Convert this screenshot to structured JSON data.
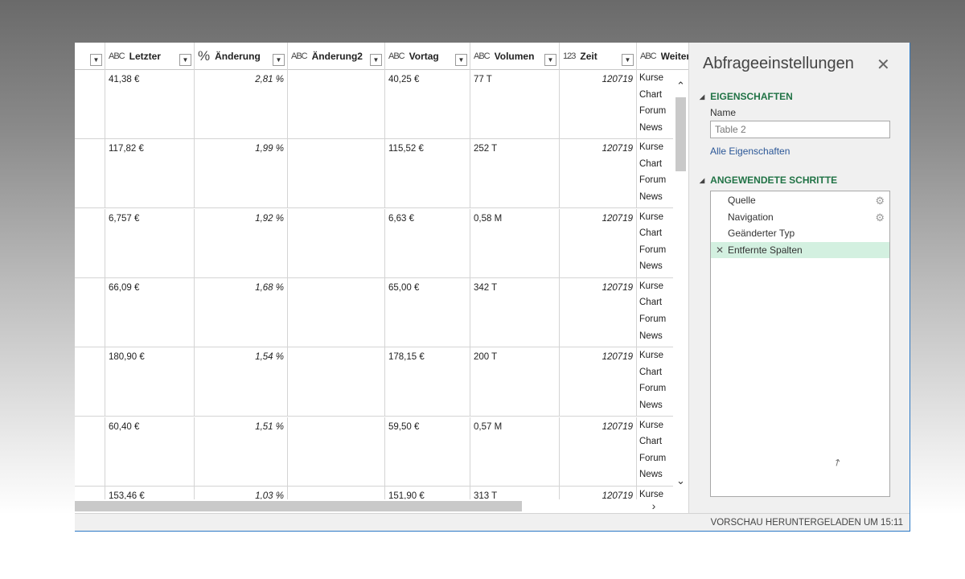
{
  "grid": {
    "columns": [
      {
        "type": "",
        "label": ""
      },
      {
        "type": "ABC",
        "label": "Letzter"
      },
      {
        "type": "%",
        "label": "Änderung"
      },
      {
        "type": "ABC",
        "label": "Änderung2"
      },
      {
        "type": "ABC",
        "label": "Vortag"
      },
      {
        "type": "ABC",
        "label": "Volumen"
      },
      {
        "type": "123",
        "label": "Zeit"
      },
      {
        "type": "ABC",
        "label": "Weiter"
      }
    ],
    "rows": [
      {
        "letzter": "41,38 €",
        "aenderung": "2,81 %",
        "aenderung2": "",
        "vortag": "40,25 €",
        "volumen": "77 T",
        "zeit": "120719",
        "links": [
          "Kurse",
          "Chart",
          "Forum",
          "News"
        ]
      },
      {
        "letzter": "117,82 €",
        "aenderung": "1,99 %",
        "aenderung2": "",
        "vortag": "115,52 €",
        "volumen": "252 T",
        "zeit": "120719",
        "links": [
          "Kurse",
          "Chart",
          "Forum",
          "News"
        ]
      },
      {
        "letzter": "6,757 €",
        "aenderung": "1,92 %",
        "aenderung2": "",
        "vortag": "6,63 €",
        "volumen": "0,58 M",
        "zeit": "120719",
        "links": [
          "Kurse",
          "Chart",
          "Forum",
          "News"
        ]
      },
      {
        "letzter": "66,09 €",
        "aenderung": "1,68 %",
        "aenderung2": "",
        "vortag": "65,00 €",
        "volumen": "342 T",
        "zeit": "120719",
        "links": [
          "Kurse",
          "Chart",
          "Forum",
          "News"
        ]
      },
      {
        "letzter": "180,90 €",
        "aenderung": "1,54 %",
        "aenderung2": "",
        "vortag": "178,15 €",
        "volumen": "200 T",
        "zeit": "120719",
        "links": [
          "Kurse",
          "Chart",
          "Forum",
          "News"
        ]
      },
      {
        "letzter": "60,40 €",
        "aenderung": "1,51 %",
        "aenderung2": "",
        "vortag": "59,50 €",
        "volumen": "0,57 M",
        "zeit": "120719",
        "links": [
          "Kurse",
          "Chart",
          "Forum",
          "News"
        ]
      },
      {
        "letzter": "153,46 €",
        "aenderung": "1,03 %",
        "aenderung2": "",
        "vortag": "151,90 €",
        "volumen": "313 T",
        "zeit": "120719",
        "links": [
          "Kurse"
        ]
      }
    ]
  },
  "pane": {
    "title": "Abfrageeinstellungen",
    "properties_heading": "EIGENSCHAFTEN",
    "name_label": "Name",
    "name_value": "Table 2",
    "all_properties_link": "Alle Eigenschaften",
    "steps_heading": "ANGEWENDETE SCHRITTE",
    "steps": [
      {
        "label": "Quelle",
        "has_gear": true,
        "active": false
      },
      {
        "label": "Navigation",
        "has_gear": true,
        "active": false
      },
      {
        "label": "Geänderter Typ",
        "has_gear": false,
        "active": false
      },
      {
        "label": "Entfernte Spalten",
        "has_gear": false,
        "active": true
      }
    ]
  },
  "status": {
    "text": "VORSCHAU HERUNTERGELADEN UM 15:11"
  },
  "icons": {
    "filter": "dropdown-arrow-icon",
    "close": "close-icon",
    "gear": "gear-icon",
    "delete_step": "delete-step-icon"
  },
  "colors": {
    "accent": "#217346",
    "active_step": "#d3f0e0",
    "window_border": "#2b78c5",
    "link": "#2b5797"
  }
}
